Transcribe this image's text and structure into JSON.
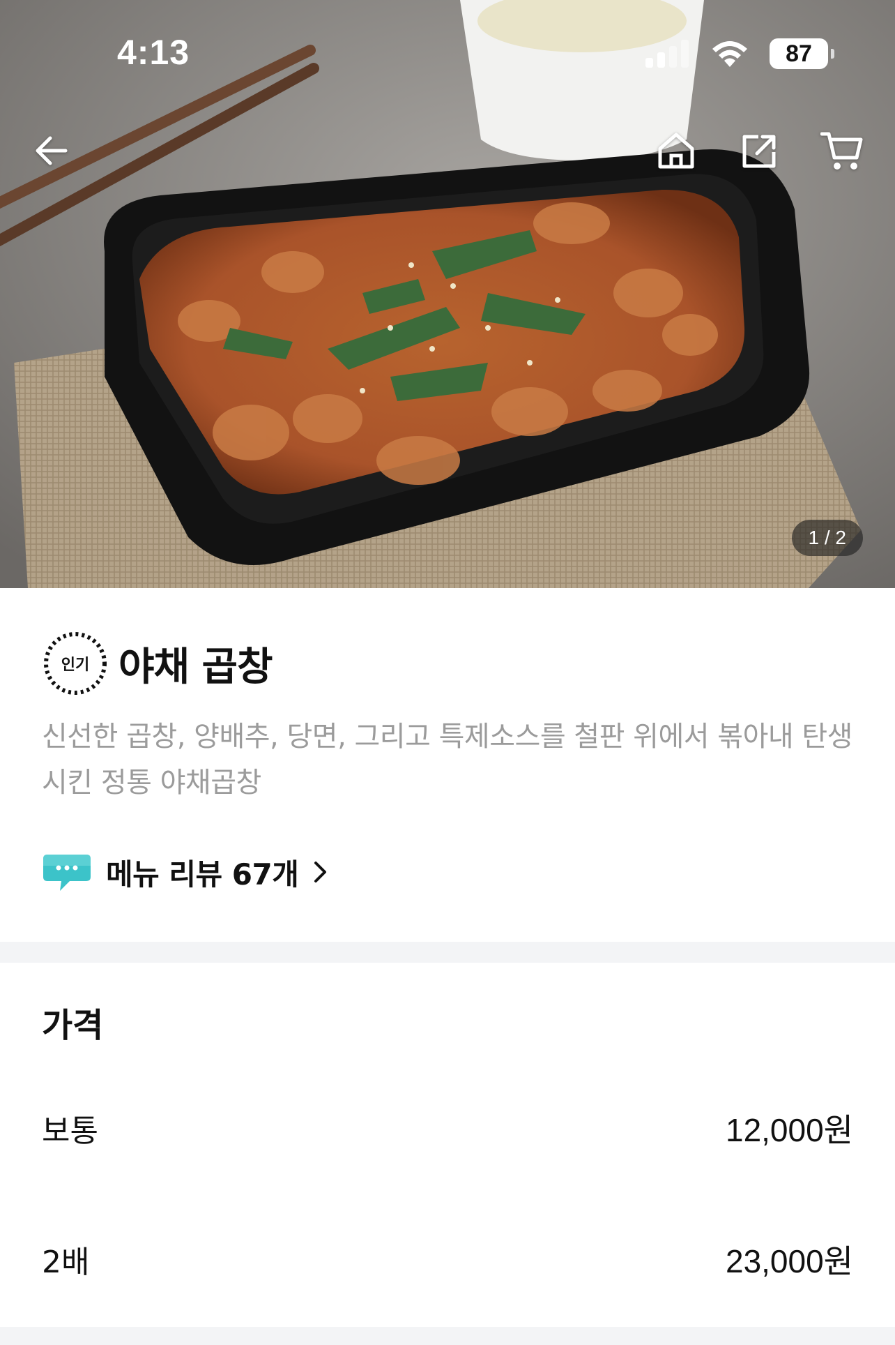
{
  "status_bar": {
    "time": "4:13",
    "battery": "87"
  },
  "header_nav": {
    "back_icon": "arrow-left-icon",
    "home_icon": "home-icon",
    "share_icon": "share-icon",
    "cart_icon": "cart-icon"
  },
  "hero": {
    "page_indicator": "1 / 2"
  },
  "menu": {
    "badge": "인기",
    "title": "야채 곱창",
    "description": "신선한 곱창, 양배추, 당면, 그리고 특제소스를 철판 위에서 볶아내 탄생시킨 정통 야채곱창",
    "review_link": "메뉴 리뷰 67개"
  },
  "price": {
    "heading": "가격",
    "options": [
      {
        "name": "보통",
        "amount": "12,000원"
      },
      {
        "name": "2배",
        "amount": "23,000원"
      }
    ]
  },
  "colors": {
    "accent_review_bubble": "#3cc3c9",
    "muted_text": "#9b9b9b",
    "divider": "#f3f4f6"
  }
}
